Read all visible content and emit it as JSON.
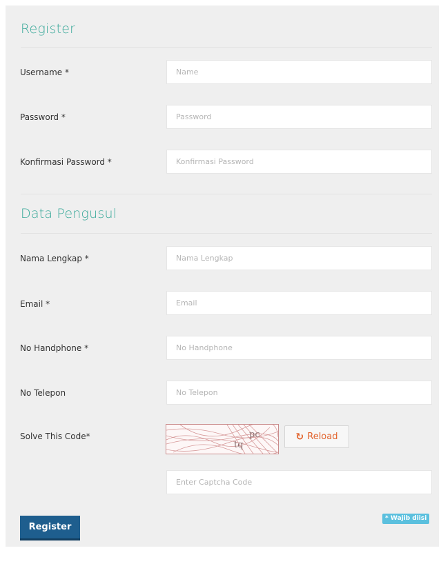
{
  "form": {
    "section_register": "Register",
    "section_data": "Data Pengusul",
    "register_button": "Register",
    "required_note": "* Wajib diisi",
    "fields": {
      "username": {
        "label": "Username *",
        "placeholder": "Name",
        "value": ""
      },
      "password": {
        "label": "Password *",
        "placeholder": "Password",
        "value": ""
      },
      "confirm_password": {
        "label": "Konfirmasi Password *",
        "placeholder": "Konfirmasi Password",
        "value": ""
      },
      "full_name": {
        "label": "Nama Lengkap *",
        "placeholder": "Nama Lengkap",
        "value": ""
      },
      "email": {
        "label": "Email *",
        "placeholder": "Email",
        "value": ""
      },
      "mobile": {
        "label": "No Handphone *",
        "placeholder": "No Handphone",
        "value": ""
      },
      "phone": {
        "label": "No Telepon",
        "placeholder": "No Telepon",
        "value": ""
      },
      "captcha_code": {
        "label": "Solve This Code*",
        "placeholder": "Enter Captcha Code",
        "value": ""
      }
    },
    "captcha": {
      "text_1": "pc",
      "text_2": "tq",
      "reload_label": "Reload",
      "reload_icon": "refresh-icon"
    }
  },
  "colors": {
    "section_title": "#3aa99a",
    "primary_button": "#1e5e8e",
    "reload_text": "#e2622b",
    "required_badge": "#5bc0de"
  }
}
